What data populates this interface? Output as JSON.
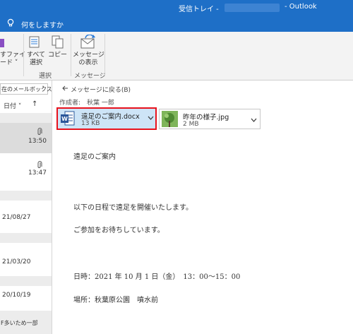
{
  "titlebar": {
    "folder": "受信トレイ - ",
    "app": "- Outlook"
  },
  "tellme": {
    "text": "何をしますか"
  },
  "ribbon": {
    "cut_label_1": "すファイ",
    "cut_label_2": "ード ˅",
    "select_all_line1": "すべて",
    "select_all_line2": "選択",
    "copy_label": "コピー",
    "show_msg_line1": "メッセージ",
    "show_msg_line2": "の表示",
    "group_select": "選択",
    "group_message": "メッセージ"
  },
  "leftpanel": {
    "mailbox_label": "在のメールボックス",
    "sort_label": "日付 ˅",
    "sort_arrow": "↑",
    "times": [
      "13:50",
      "13:47"
    ],
    "dates": [
      "21/08/27",
      "21/03/20",
      "20/10/19"
    ],
    "bottom_text": "F多いため一部"
  },
  "reading": {
    "back_link": "メッセージに戻る(B)",
    "sender": "作成者:　秋葉 一郎",
    "attachments": [
      {
        "name": "遠足のご案内.docx",
        "size": "13 KB",
        "icon": "word-icon",
        "selected": true
      },
      {
        "name": "昨年の様子.jpg",
        "size": "2 MB",
        "icon": "image-thumbnail-icon",
        "selected": false
      }
    ],
    "body_lines": [
      "遠足のご案内",
      "以下の日程で遠足を開催いたします。",
      "ご参加をお待ちしています。",
      "日時：2021 年 10 月 1 日（金）　13：00～15：00",
      "場所：秋葉原公園　噴水前"
    ]
  },
  "colors": {
    "titlebar": "#1e6fc7",
    "selection_border": "#e8121c",
    "attachment_selected_bg": "#cde4f7"
  }
}
